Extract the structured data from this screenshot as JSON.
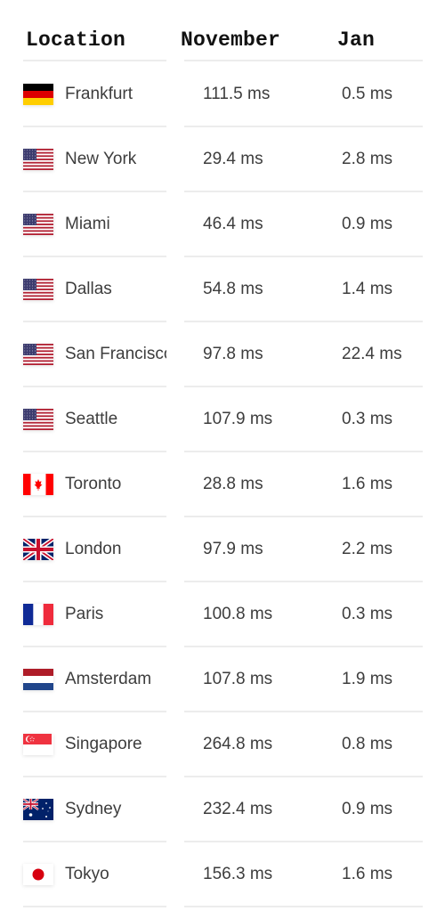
{
  "table": {
    "headers": {
      "location": "Location",
      "november": "November",
      "jan": "Jan"
    },
    "rows": [
      {
        "city": "Frankfurt",
        "country_flag": "germany-flag-icon",
        "november": "111.5 ms",
        "jan": "0.5 ms"
      },
      {
        "city": "New York",
        "country_flag": "usa-flag-icon",
        "november": "29.4 ms",
        "jan": "2.8 ms"
      },
      {
        "city": "Miami",
        "country_flag": "usa-flag-icon",
        "november": "46.4 ms",
        "jan": "0.9 ms"
      },
      {
        "city": "Dallas",
        "country_flag": "usa-flag-icon",
        "november": "54.8 ms",
        "jan": "1.4 ms"
      },
      {
        "city": "San Francisco",
        "country_flag": "usa-flag-icon",
        "november": "97.8 ms",
        "jan": "22.4 ms"
      },
      {
        "city": "Seattle",
        "country_flag": "usa-flag-icon",
        "november": "107.9 ms",
        "jan": "0.3 ms"
      },
      {
        "city": "Toronto",
        "country_flag": "canada-flag-icon",
        "november": "28.8 ms",
        "jan": "1.6 ms"
      },
      {
        "city": "London",
        "country_flag": "uk-flag-icon",
        "november": "97.9 ms",
        "jan": "2.2 ms"
      },
      {
        "city": "Paris",
        "country_flag": "france-flag-icon",
        "november": "100.8 ms",
        "jan": "0.3 ms"
      },
      {
        "city": "Amsterdam",
        "country_flag": "netherlands-flag-icon",
        "november": "107.8 ms",
        "jan": "1.9 ms"
      },
      {
        "city": "Singapore",
        "country_flag": "singapore-flag-icon",
        "november": "264.8 ms",
        "jan": "0.8 ms"
      },
      {
        "city": "Sydney",
        "country_flag": "australia-flag-icon",
        "november": "232.4 ms",
        "jan": "0.9 ms"
      },
      {
        "city": "Tokyo",
        "country_flag": "japan-flag-icon",
        "november": "156.3 ms",
        "jan": "1.6 ms"
      }
    ]
  },
  "colors": {
    "text": "#3d3d3d",
    "header_text": "#111111",
    "divider": "#ececec"
  }
}
